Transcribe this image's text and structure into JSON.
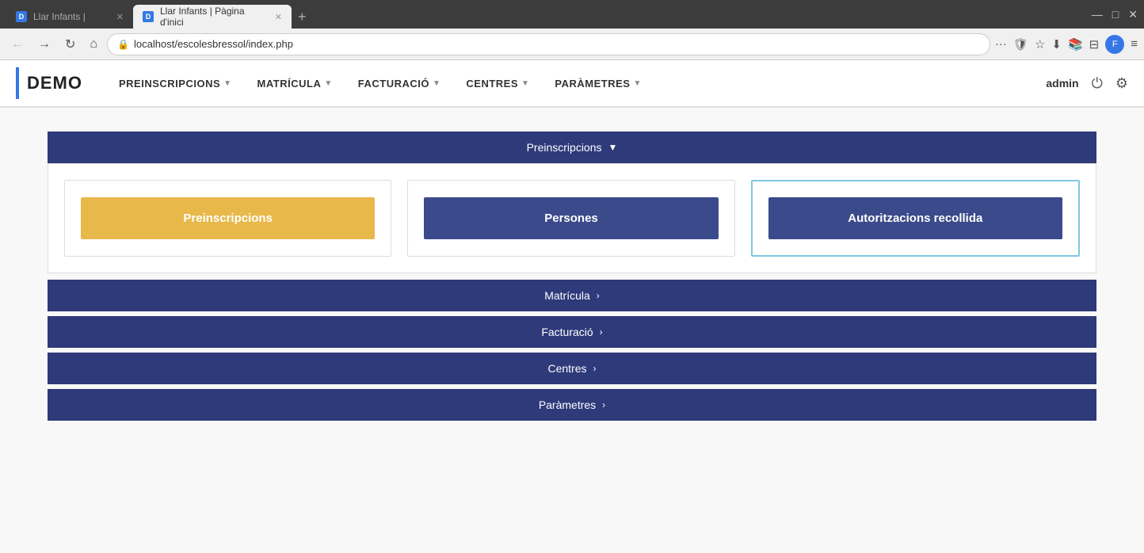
{
  "browser": {
    "tabs": [
      {
        "id": "tab1",
        "favicon": "D",
        "label": "Llar Infants |",
        "active": false
      },
      {
        "id": "tab2",
        "favicon": "D",
        "label": "Llar Infants | Pàgina d'inici",
        "active": true
      }
    ],
    "new_tab_label": "+",
    "window_controls": {
      "minimize": "—",
      "maximize": "□",
      "close": "✕"
    },
    "url": "localhost/escolesbressol/index.php",
    "toolbar_icons": {
      "more": "···",
      "shield": "🛡",
      "star": "☆",
      "download": "⬇",
      "library": "📚",
      "sidebar": "⊟",
      "profile": "👤",
      "menu": "≡"
    }
  },
  "app": {
    "logo": "DEMO",
    "nav": [
      {
        "id": "preinscripcions",
        "label": "PREINSCRIPCIONS",
        "has_arrow": true
      },
      {
        "id": "matricula",
        "label": "MATRÍCULA",
        "has_arrow": true
      },
      {
        "id": "facturacio",
        "label": "FACTURACIÓ",
        "has_arrow": true
      },
      {
        "id": "centres",
        "label": "CENTRES",
        "has_arrow": true
      },
      {
        "id": "parametres",
        "label": "PARÀMETRES",
        "has_arrow": true
      }
    ],
    "user": "admin",
    "power_icon": "⏻",
    "settings_icon": "⚙"
  },
  "main": {
    "preinscripcions_section": {
      "header": "Preinscripcions",
      "header_arrow": "▼",
      "cards": [
        {
          "id": "preinscripcions-btn",
          "label": "Preinscripcions",
          "style": "yellow"
        },
        {
          "id": "persones-btn",
          "label": "Persones",
          "style": "purple"
        },
        {
          "id": "autoritzacions-btn",
          "label": "Autoritzacions recollida",
          "style": "purple-dark"
        }
      ]
    },
    "sections": [
      {
        "id": "matricula-section",
        "label": "Matrícula",
        "arrow": "›"
      },
      {
        "id": "facturacio-section",
        "label": "Facturació",
        "arrow": "›"
      },
      {
        "id": "centres-section",
        "label": "Centres",
        "arrow": "›"
      },
      {
        "id": "parametres-section",
        "label": "Paràmetres",
        "arrow": "›"
      }
    ]
  },
  "colors": {
    "nav_bg": "#2e3a7a",
    "yellow_btn": "#e8b84b",
    "purple_btn": "#3b4a8a",
    "accent_blue": "#3578e5"
  }
}
